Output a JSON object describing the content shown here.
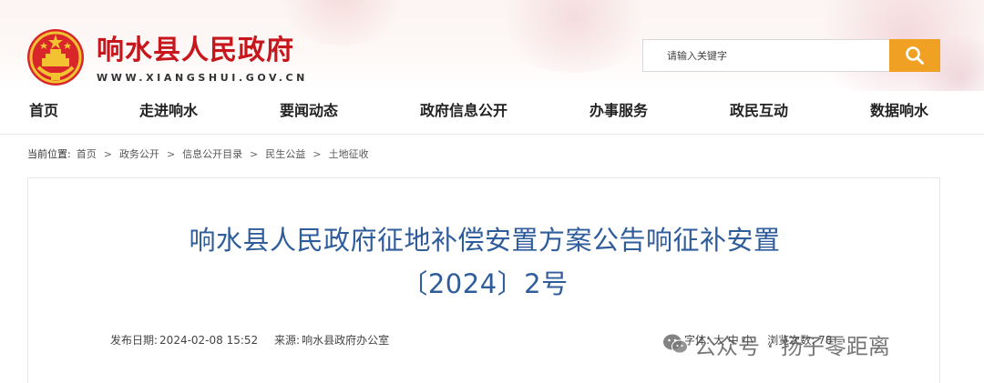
{
  "header": {
    "site_name": "响水县人民政府",
    "site_domain": "WWW.XIANGSHUI.GOV.CN",
    "emblem_icon": "national-emblem-icon",
    "search": {
      "placeholder": "请输入关键字",
      "button_icon": "search-icon",
      "button_color": "#f0a023"
    }
  },
  "nav": {
    "items": [
      {
        "label": "首页"
      },
      {
        "label": "走进响水"
      },
      {
        "label": "要闻动态"
      },
      {
        "label": "政府信息公开"
      },
      {
        "label": "办事服务"
      },
      {
        "label": "政民互动"
      },
      {
        "label": "数据响水"
      }
    ]
  },
  "breadcrumb": {
    "label": "当前位置:",
    "items": [
      {
        "label": "首页"
      },
      {
        "label": "政务公开"
      },
      {
        "label": "信息公开目录"
      },
      {
        "label": "民生公益"
      },
      {
        "label": "土地征收"
      }
    ],
    "separator": ">"
  },
  "article": {
    "title_line1": "响水县人民政府征地补偿安置方案公告响征补安置",
    "title_line2": "〔2024〕2号",
    "publish_label": "发布日期:",
    "publish_date": "2024-02-08 15:52",
    "source_label": "来源:",
    "source": "响水县政府办公室",
    "font_label": "字体:",
    "font_large": "大",
    "font_medium": "中",
    "font_small": "小",
    "views_label": "浏览次数:",
    "views": "78"
  },
  "watermark": {
    "icon": "wechat-icon",
    "text": "公众号 · 扬子零距离"
  },
  "colors": {
    "brand_red": "#c8161d",
    "title_blue": "#2f5d9c",
    "search_orange": "#f0a023"
  }
}
